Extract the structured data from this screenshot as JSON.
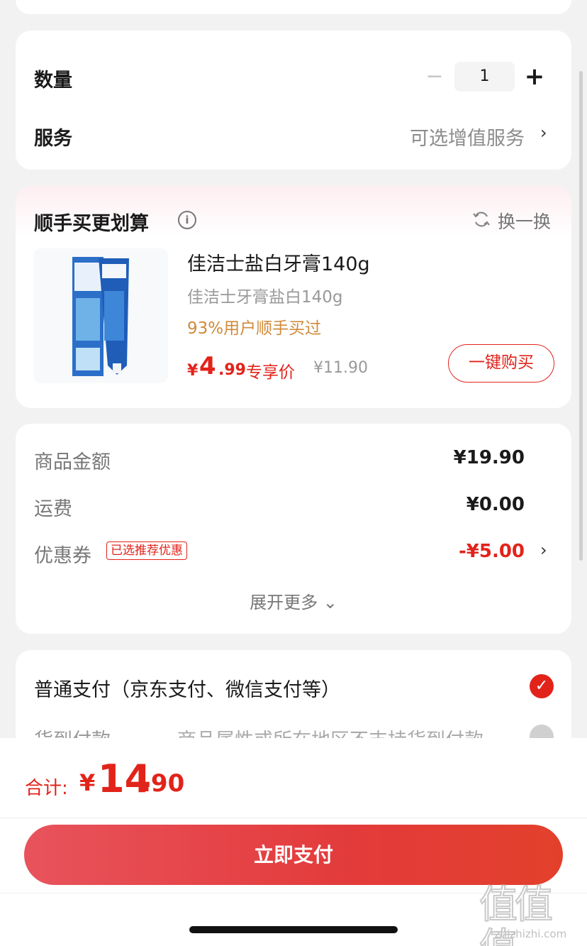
{
  "order": {
    "quantity_label": "数量",
    "quantity_minus": "−",
    "quantity_value": "1",
    "quantity_plus": "+",
    "service_label": "服务",
    "service_value": "可选增值服务",
    "chevron": "›"
  },
  "bundle": {
    "title": "顺手买更划算",
    "info_glyph": "i",
    "refresh_label": "换一换",
    "product": {
      "name": "佳洁士盐白牙膏140g",
      "subtitle": "佳洁士牙膏盐白140g",
      "buyers": "93%用户顺手买过",
      "price_symbol": "¥",
      "price_int": "4",
      "price_dec": ".99",
      "price_tag": "专享价",
      "original_price": "¥11.90",
      "buy_label": "一键购买"
    }
  },
  "amounts": {
    "goods_label": "商品金额",
    "goods_value": "¥19.90",
    "shipping_label": "运费",
    "shipping_value": "¥0.00",
    "coupon_label": "优惠券",
    "coupon_badge": "已选推荐优惠",
    "coupon_value": "-¥5.00",
    "expand_label": "展开更多 ⌄"
  },
  "payment": {
    "option_normal": "普通支付（京东支付、微信支付等）",
    "check_glyph": "✓",
    "option_cod": "货到付款",
    "cod_note": "商品属性或所在地区不支持货到付款"
  },
  "footer": {
    "total_label": "合计:",
    "total_symbol": "¥",
    "total_int": "14",
    "total_dec": ".90",
    "pay_button": "立即支付"
  },
  "watermark": {
    "glyphs": "值值值",
    "url": "zhizhizhi.com"
  },
  "colors": {
    "accent": "#e2231a",
    "background": "#f2f2f2",
    "buyers_text": "#d08a3a"
  }
}
